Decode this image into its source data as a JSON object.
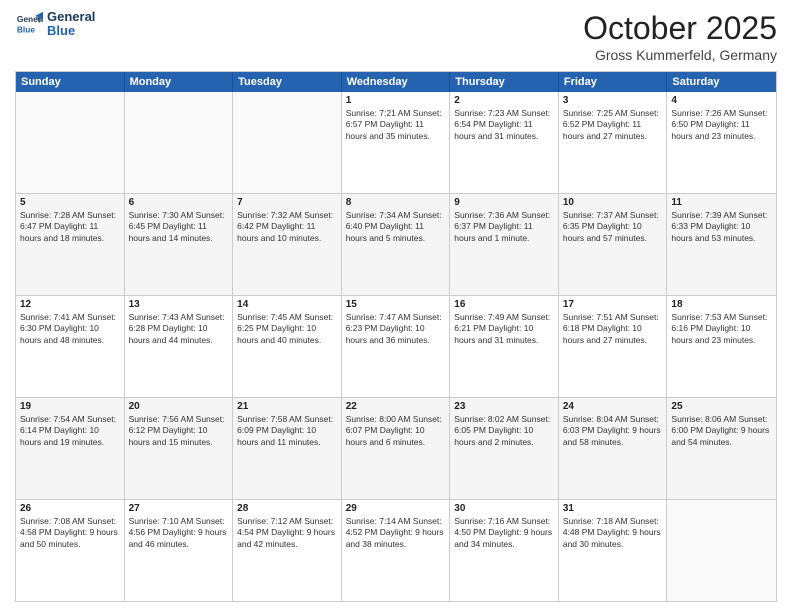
{
  "logo": {
    "line1": "General",
    "line2": "Blue"
  },
  "title": "October 2025",
  "location": "Gross Kummerfeld, Germany",
  "header_days": [
    "Sunday",
    "Monday",
    "Tuesday",
    "Wednesday",
    "Thursday",
    "Friday",
    "Saturday"
  ],
  "rows": [
    [
      {
        "day": "",
        "info": ""
      },
      {
        "day": "",
        "info": ""
      },
      {
        "day": "",
        "info": ""
      },
      {
        "day": "1",
        "info": "Sunrise: 7:21 AM\nSunset: 6:57 PM\nDaylight: 11 hours\nand 35 minutes."
      },
      {
        "day": "2",
        "info": "Sunrise: 7:23 AM\nSunset: 6:54 PM\nDaylight: 11 hours\nand 31 minutes."
      },
      {
        "day": "3",
        "info": "Sunrise: 7:25 AM\nSunset: 6:52 PM\nDaylight: 11 hours\nand 27 minutes."
      },
      {
        "day": "4",
        "info": "Sunrise: 7:26 AM\nSunset: 6:50 PM\nDaylight: 11 hours\nand 23 minutes."
      }
    ],
    [
      {
        "day": "5",
        "info": "Sunrise: 7:28 AM\nSunset: 6:47 PM\nDaylight: 11 hours\nand 18 minutes."
      },
      {
        "day": "6",
        "info": "Sunrise: 7:30 AM\nSunset: 6:45 PM\nDaylight: 11 hours\nand 14 minutes."
      },
      {
        "day": "7",
        "info": "Sunrise: 7:32 AM\nSunset: 6:42 PM\nDaylight: 11 hours\nand 10 minutes."
      },
      {
        "day": "8",
        "info": "Sunrise: 7:34 AM\nSunset: 6:40 PM\nDaylight: 11 hours\nand 5 minutes."
      },
      {
        "day": "9",
        "info": "Sunrise: 7:36 AM\nSunset: 6:37 PM\nDaylight: 11 hours\nand 1 minute."
      },
      {
        "day": "10",
        "info": "Sunrise: 7:37 AM\nSunset: 6:35 PM\nDaylight: 10 hours\nand 57 minutes."
      },
      {
        "day": "11",
        "info": "Sunrise: 7:39 AM\nSunset: 6:33 PM\nDaylight: 10 hours\nand 53 minutes."
      }
    ],
    [
      {
        "day": "12",
        "info": "Sunrise: 7:41 AM\nSunset: 6:30 PM\nDaylight: 10 hours\nand 48 minutes."
      },
      {
        "day": "13",
        "info": "Sunrise: 7:43 AM\nSunset: 6:28 PM\nDaylight: 10 hours\nand 44 minutes."
      },
      {
        "day": "14",
        "info": "Sunrise: 7:45 AM\nSunset: 6:25 PM\nDaylight: 10 hours\nand 40 minutes."
      },
      {
        "day": "15",
        "info": "Sunrise: 7:47 AM\nSunset: 6:23 PM\nDaylight: 10 hours\nand 36 minutes."
      },
      {
        "day": "16",
        "info": "Sunrise: 7:49 AM\nSunset: 6:21 PM\nDaylight: 10 hours\nand 31 minutes."
      },
      {
        "day": "17",
        "info": "Sunrise: 7:51 AM\nSunset: 6:18 PM\nDaylight: 10 hours\nand 27 minutes."
      },
      {
        "day": "18",
        "info": "Sunrise: 7:53 AM\nSunset: 6:16 PM\nDaylight: 10 hours\nand 23 minutes."
      }
    ],
    [
      {
        "day": "19",
        "info": "Sunrise: 7:54 AM\nSunset: 6:14 PM\nDaylight: 10 hours\nand 19 minutes."
      },
      {
        "day": "20",
        "info": "Sunrise: 7:56 AM\nSunset: 6:12 PM\nDaylight: 10 hours\nand 15 minutes."
      },
      {
        "day": "21",
        "info": "Sunrise: 7:58 AM\nSunset: 6:09 PM\nDaylight: 10 hours\nand 11 minutes."
      },
      {
        "day": "22",
        "info": "Sunrise: 8:00 AM\nSunset: 6:07 PM\nDaylight: 10 hours\nand 6 minutes."
      },
      {
        "day": "23",
        "info": "Sunrise: 8:02 AM\nSunset: 6:05 PM\nDaylight: 10 hours\nand 2 minutes."
      },
      {
        "day": "24",
        "info": "Sunrise: 8:04 AM\nSunset: 6:03 PM\nDaylight: 9 hours\nand 58 minutes."
      },
      {
        "day": "25",
        "info": "Sunrise: 8:06 AM\nSunset: 6:00 PM\nDaylight: 9 hours\nand 54 minutes."
      }
    ],
    [
      {
        "day": "26",
        "info": "Sunrise: 7:08 AM\nSunset: 4:58 PM\nDaylight: 9 hours\nand 50 minutes."
      },
      {
        "day": "27",
        "info": "Sunrise: 7:10 AM\nSunset: 4:56 PM\nDaylight: 9 hours\nand 46 minutes."
      },
      {
        "day": "28",
        "info": "Sunrise: 7:12 AM\nSunset: 4:54 PM\nDaylight: 9 hours\nand 42 minutes."
      },
      {
        "day": "29",
        "info": "Sunrise: 7:14 AM\nSunset: 4:52 PM\nDaylight: 9 hours\nand 38 minutes."
      },
      {
        "day": "30",
        "info": "Sunrise: 7:16 AM\nSunset: 4:50 PM\nDaylight: 9 hours\nand 34 minutes."
      },
      {
        "day": "31",
        "info": "Sunrise: 7:18 AM\nSunset: 4:48 PM\nDaylight: 9 hours\nand 30 minutes."
      },
      {
        "day": "",
        "info": ""
      }
    ]
  ]
}
